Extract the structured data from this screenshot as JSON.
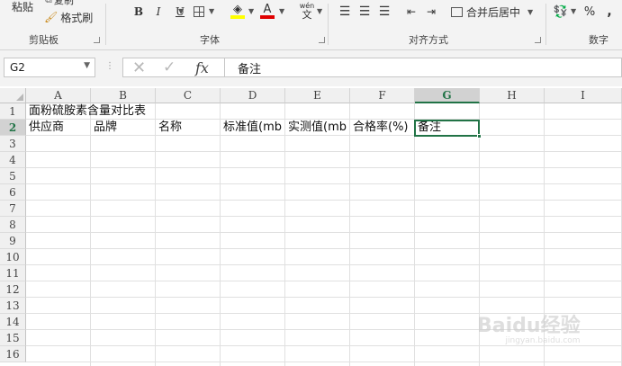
{
  "ribbon": {
    "clipboard": {
      "paste_label": "粘贴",
      "copy_label": "复制",
      "format_painter_label": "格式刷",
      "group_label": "剪贴板"
    },
    "font": {
      "bold": "B",
      "italic": "I",
      "underline": "U",
      "font_color_glyph": "A",
      "phonetic_top": "wén",
      "phonetic_bottom": "文",
      "group_label": "字体"
    },
    "alignment": {
      "merge_center_label": "合并后居中",
      "group_label": "对齐方式"
    },
    "number": {
      "percent": "%",
      "group_label": "数字"
    }
  },
  "formula_bar": {
    "name_box": "G2",
    "fx_label": "fx",
    "content": "备注"
  },
  "grid": {
    "columns": [
      "A",
      "B",
      "C",
      "D",
      "E",
      "F",
      "G",
      "H",
      "I"
    ],
    "rows": [
      "1",
      "2",
      "3",
      "4",
      "5",
      "6",
      "7",
      "8",
      "9",
      "10",
      "11",
      "12",
      "13",
      "14",
      "15",
      "16"
    ],
    "selected_column": "G",
    "selected_row": "2",
    "cells": {
      "A1": "面粉硫胺素含量对比表",
      "A2": "供应商",
      "B2": "品牌",
      "C2": "名称",
      "D2": "标准值(mb",
      "E2": "实测值(mb",
      "F2": "合格率(%)",
      "G2": "备注"
    }
  },
  "watermark": {
    "text": "Baidu经验",
    "sub": "jingyan.baidu.com"
  },
  "colors": {
    "accent": "#217346",
    "font_color_underline": "#e00000",
    "fill_color_underline": "#ffff00"
  }
}
